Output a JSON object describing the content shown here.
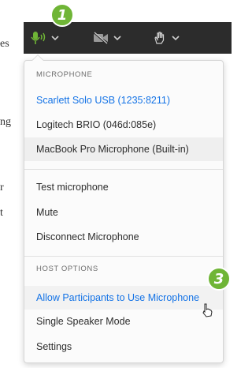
{
  "background_text": [
    "es",
    "ng",
    "r",
    "t"
  ],
  "callouts": [
    "1",
    "3"
  ],
  "toolbar": {
    "mic": {
      "icon": "microphone-icon",
      "state_color": "#6fb536"
    },
    "camera": {
      "icon": "camera-off-icon"
    },
    "hand": {
      "icon": "hand-raise-icon"
    }
  },
  "menu": {
    "microphone_header": "MICROPHONE",
    "devices": [
      "Scarlett Solo USB (1235:8211)",
      "Logitech BRIO (046d:085e)",
      "MacBook Pro Microphone (Built-in)"
    ],
    "actions": [
      "Test microphone",
      "Mute",
      "Disconnect Microphone"
    ],
    "host_header": "HOST OPTIONS",
    "host_options": [
      "Allow Participants to Use Microphone",
      "Single Speaker Mode",
      "Settings"
    ]
  },
  "colors": {
    "accent": "#1473e6",
    "callout": "#6fb536",
    "toolbar": "#2c2c2c"
  }
}
